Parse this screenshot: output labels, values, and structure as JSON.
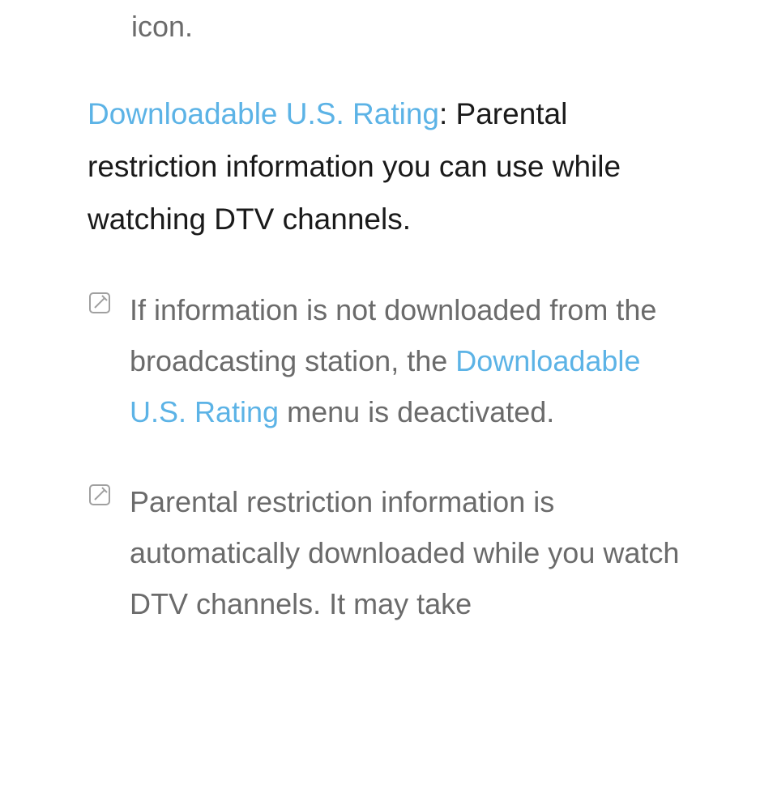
{
  "fragment_top": "icon.",
  "main": {
    "blue_label": "Downloadable U.S. Rating",
    "rest": ": Parental restriction information you can use while watching DTV channels."
  },
  "note1": {
    "part1": "If information is not downloaded from the broadcasting station, the ",
    "blue": "Downloadable U.S. Rating",
    "part2": " menu is deactivated."
  },
  "note2": {
    "text": "Parental restriction information is automatically downloaded while you watch DTV channels. It may take"
  }
}
